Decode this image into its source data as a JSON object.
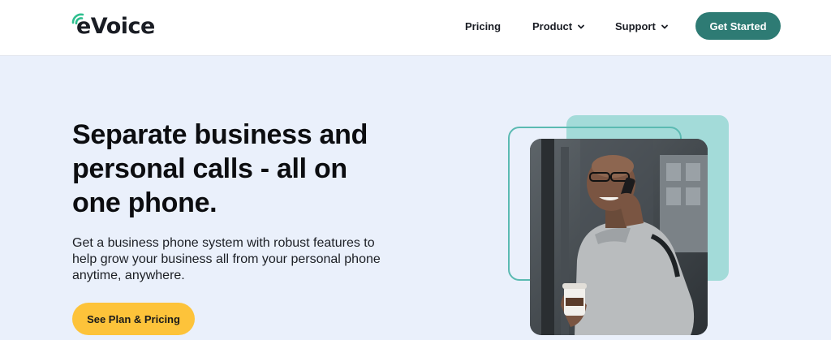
{
  "header": {
    "logo_text": "eVoice",
    "nav": [
      {
        "label": "Pricing",
        "has_dropdown": false
      },
      {
        "label": "Product",
        "has_dropdown": true
      },
      {
        "label": "Support",
        "has_dropdown": true
      }
    ],
    "cta_label": "Get Started"
  },
  "hero": {
    "headline": "Separate business and personal calls - all on one phone.",
    "subtext": "Get a business phone system with robust features to help grow your business all from your personal phone anytime, anywhere.",
    "button_label": "See Plan & Pricing"
  },
  "colors": {
    "brand_teal": "#2e7b74",
    "accent_yellow": "#fdc33a",
    "hero_background": "#eaf0fb",
    "deco_light_teal": "#a3dbd9"
  },
  "icons": {
    "logo": "signal-arcs-icon",
    "dropdown": "chevron-down-icon"
  }
}
